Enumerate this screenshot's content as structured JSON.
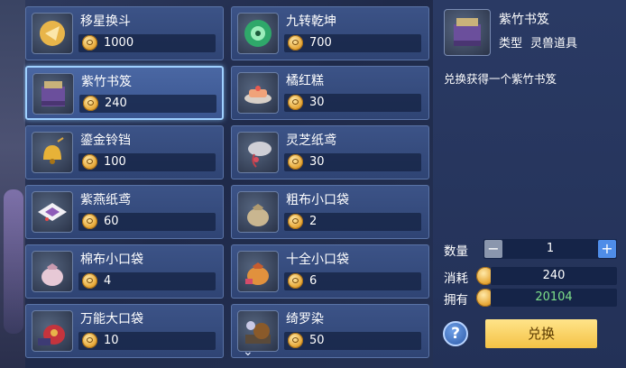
{
  "shop": {
    "items": [
      {
        "name": "移星换斗",
        "price": "1000",
        "icon": "gold-star-swap-icon"
      },
      {
        "name": "九转乾坤",
        "price": "700",
        "icon": "green-swirl-orb-icon"
      },
      {
        "name": "紫竹书笈",
        "price": "240",
        "icon": "purple-bamboo-book-box-icon"
      },
      {
        "name": "橘红糕",
        "price": "30",
        "icon": "orange-cake-icon"
      },
      {
        "name": "鎏金铃铛",
        "price": "100",
        "icon": "gold-bell-icon"
      },
      {
        "name": "灵芝纸鸢",
        "price": "30",
        "icon": "lingzhi-kite-icon"
      },
      {
        "name": "紫燕纸鸢",
        "price": "60",
        "icon": "purple-swallow-kite-icon"
      },
      {
        "name": "粗布小口袋",
        "price": "2",
        "icon": "coarse-cloth-pouch-icon"
      },
      {
        "name": "棉布小口袋",
        "price": "4",
        "icon": "cotton-pouch-icon"
      },
      {
        "name": "十全小口袋",
        "price": "6",
        "icon": "lucky-pouch-icon"
      },
      {
        "name": "万能大口袋",
        "price": "10",
        "icon": "big-bag-icon"
      },
      {
        "name": "绮罗染",
        "price": "50",
        "icon": "silk-dye-icon"
      }
    ],
    "selected_index": 2,
    "scroll_more": "⌄"
  },
  "detail": {
    "title": "紫竹书笈",
    "type_label": "类型",
    "type_value": "灵兽道具",
    "description": "兑换获得一个紫竹书笈",
    "quantity_label": "数量",
    "quantity_value": "1",
    "minus": "−",
    "plus": "+",
    "cost_label": "消耗",
    "cost_value": "240",
    "owned_label": "拥有",
    "owned_value": "20104",
    "help": "?",
    "exchange_button": "兑换"
  },
  "colors": {
    "accent_gold": "#f4c245",
    "owned_green": "#7ee08a",
    "selected_border": "#9fd0ff"
  }
}
